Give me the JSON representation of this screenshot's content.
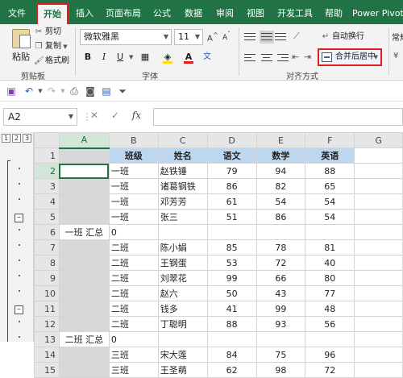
{
  "menu_tabs": [
    "文件",
    "开始",
    "插入",
    "页面布局",
    "公式",
    "数据",
    "审阅",
    "视图",
    "开发工具",
    "帮助",
    "Power Pivot"
  ],
  "active_tab": "开始",
  "clipboard": {
    "paste": "粘贴",
    "cut": "剪切",
    "copy": "复制",
    "format_painter": "格式刷",
    "group_label": "剪贴板"
  },
  "font": {
    "name": "微软雅黑",
    "size": "11",
    "bold": "B",
    "italic": "I",
    "underline": "U",
    "group_label": "字体",
    "font_color": "#e02020",
    "fill_color": "#ffe000"
  },
  "alignment": {
    "wrap_text": "自动换行",
    "merge_center": "合并后居中",
    "group_label": "对齐方式"
  },
  "number_group_partial": "常规",
  "name_box": "A2",
  "formula_bar": {
    "cancel": "✕",
    "enter": "✓",
    "fx": "fx",
    "value": ""
  },
  "outline_levels": [
    "1",
    "2",
    "3"
  ],
  "columns": [
    "A",
    "B",
    "C",
    "D",
    "E",
    "F",
    "G"
  ],
  "rows": [
    {
      "n": "1",
      "a": "",
      "b": "班级",
      "c": "姓名",
      "d": "语文",
      "e": "数学",
      "f": "英语",
      "header": true
    },
    {
      "n": "2",
      "a": "",
      "b": "一班",
      "c": "赵铁锤",
      "d": "79",
      "e": "94",
      "f": "88"
    },
    {
      "n": "3",
      "a": "",
      "b": "一班",
      "c": "诸葛钢铁",
      "d": "86",
      "e": "82",
      "f": "65"
    },
    {
      "n": "4",
      "a": "",
      "b": "一班",
      "c": "邓芳芳",
      "d": "61",
      "e": "54",
      "f": "54"
    },
    {
      "n": "5",
      "a": "",
      "b": "一班",
      "c": "张三",
      "d": "51",
      "e": "86",
      "f": "54"
    },
    {
      "n": "6",
      "a": "一班 汇总",
      "b": "0",
      "c": "",
      "d": "",
      "e": "",
      "f": "",
      "subtotal": true
    },
    {
      "n": "7",
      "a": "",
      "b": "二班",
      "c": "陈小娟",
      "d": "85",
      "e": "78",
      "f": "81"
    },
    {
      "n": "8",
      "a": "",
      "b": "二班",
      "c": "王钢蛋",
      "d": "53",
      "e": "72",
      "f": "40"
    },
    {
      "n": "9",
      "a": "",
      "b": "二班",
      "c": "刘翠花",
      "d": "99",
      "e": "66",
      "f": "80"
    },
    {
      "n": "10",
      "a": "",
      "b": "二班",
      "c": "赵六",
      "d": "50",
      "e": "43",
      "f": "77"
    },
    {
      "n": "11",
      "a": "",
      "b": "二班",
      "c": "钱多",
      "d": "41",
      "e": "99",
      "f": "48"
    },
    {
      "n": "12",
      "a": "",
      "b": "二班",
      "c": "丁聪明",
      "d": "88",
      "e": "93",
      "f": "56"
    },
    {
      "n": "13",
      "a": "二班 汇总",
      "b": "0",
      "c": "",
      "d": "",
      "e": "",
      "f": "",
      "subtotal": true
    },
    {
      "n": "14",
      "a": "",
      "b": "三班",
      "c": "宋大莲",
      "d": "84",
      "e": "75",
      "f": "96"
    },
    {
      "n": "15",
      "a": "",
      "b": "三班",
      "c": "王圣萌",
      "d": "62",
      "e": "98",
      "f": "72"
    }
  ]
}
